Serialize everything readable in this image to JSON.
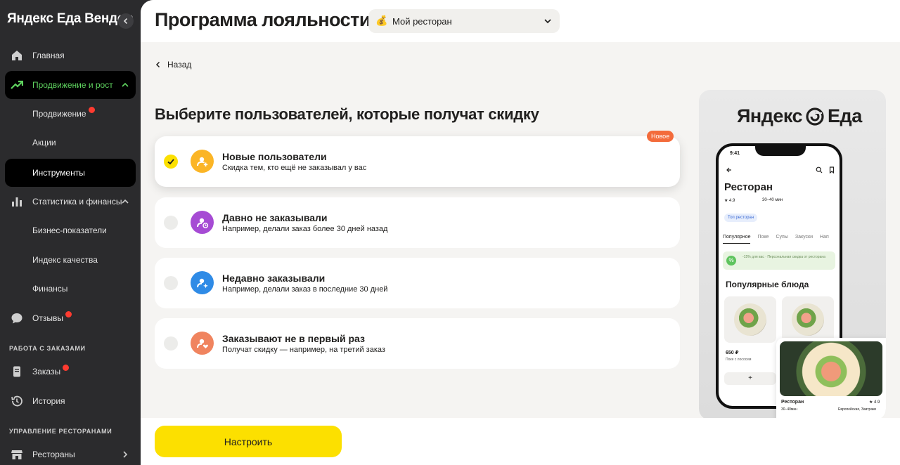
{
  "sidebar": {
    "brand": "Яндекс Еда Вендор",
    "items": [
      {
        "label": "Главная"
      },
      {
        "label": "Продвижение и рост"
      },
      {
        "label": "Продвижение"
      },
      {
        "label": "Акции"
      },
      {
        "label": "Инструменты"
      },
      {
        "label": "Статистика и финансы"
      },
      {
        "label": "Бизнес-показатели"
      },
      {
        "label": "Индекс качества"
      },
      {
        "label": "Финансы"
      },
      {
        "label": "Отзывы"
      },
      {
        "label": "Заказы"
      },
      {
        "label": "История"
      },
      {
        "label": "Рестораны"
      }
    ],
    "sections": {
      "orders": "РАБОТА С ЗАКАЗАМИ",
      "restaurants": "УПРАВЛЕНИЕ РЕСТОРАНАМИ"
    }
  },
  "header": {
    "title": "Программа лояльности",
    "restaurant_select": "Мой ресторан",
    "restaurant_emoji": "💰"
  },
  "main": {
    "back_label": "Назад",
    "heading": "Выберите пользователей, которые получат скидку",
    "badge_new": "Новое",
    "options": [
      {
        "title": "Новые пользователи",
        "subtitle": "Скидка тем, кто ещё не заказывал у вас",
        "color": "#fbb526",
        "selected": true
      },
      {
        "title": "Давно не заказывали",
        "subtitle": "Например, делали заказ более 30 дней назад",
        "color": "#a64bd4",
        "selected": false
      },
      {
        "title": "Недавно заказывали",
        "subtitle": "Например, делали заказ в последние 30 дней",
        "color": "#2f8be6",
        "selected": false
      },
      {
        "title": "Заказывают не в первый раз",
        "subtitle": "Получат скидку — например, на третий заказ",
        "color": "#f0845f",
        "selected": false
      }
    ],
    "setup_button": "Настроить"
  },
  "promo": {
    "logo_left": "Яндекс",
    "logo_right": "Еда",
    "phone_time": "9:41",
    "restaurant": "Ресторан",
    "rating": "★ 4.9",
    "delivery": "30–40 мин",
    "tag": "Топ ресторан",
    "tabs": [
      "Популярное",
      "Поке",
      "Супы",
      "Закуски",
      "Нап"
    ],
    "banner_pct": "%",
    "banner_text": "-15% для вас · Персональная скидка от ресторана",
    "popular_title": "Популярные блюда",
    "price": "650 ₽",
    "dish": "Поке с лососем",
    "plus": "+",
    "card_name": "Ресторан",
    "card_rating": "★ 4.9",
    "card_delivery": "30–40мин",
    "card_category": "Европейская, Завтраки"
  }
}
